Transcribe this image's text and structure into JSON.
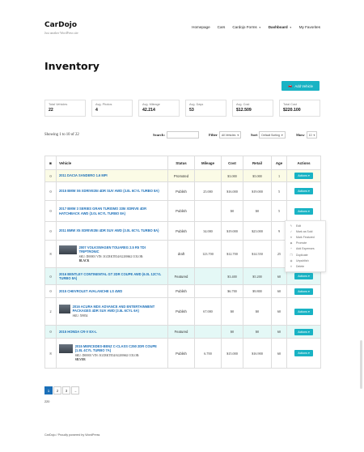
{
  "site": {
    "brand": "CarDojo",
    "tagline": "Just another WordPress site"
  },
  "nav": [
    {
      "label": "Homepage",
      "chevron": false
    },
    {
      "label": "Cars",
      "chevron": false
    },
    {
      "label": "Cardojo Forms",
      "chevron": true
    },
    {
      "label": "Dashboard",
      "chevron": true,
      "bold": true
    },
    {
      "label": "My Favorites",
      "chevron": false
    }
  ],
  "page_title": "Inventory",
  "add_vehicle": {
    "icon": "car-icon",
    "label": "Add Vehicle"
  },
  "stats": [
    {
      "label": "Total Vehicles",
      "value": "22"
    },
    {
      "label": "Avg. Photos",
      "value": "4"
    },
    {
      "label": "Avg. Mileage",
      "value": "42.214"
    },
    {
      "label": "Avg. Days",
      "value": "53"
    },
    {
      "label": "Avg. Cost",
      "value": "$12.509"
    },
    {
      "label": "Total Cost",
      "value": "$220.100"
    }
  ],
  "showing": "Showing 1 to 10 of 22",
  "controls": {
    "search_label": "Search:",
    "filter_label": "Filter",
    "filter_value": "All Vehicles",
    "sort_label": "Sort",
    "sort_value": "Default Sorting",
    "show_label": "Show",
    "show_value": "10"
  },
  "table": {
    "headers": [
      "",
      "Vehicle",
      "Status",
      "Mileage",
      "Cost",
      "Retail",
      "Age",
      "Actions"
    ],
    "action_label": "Actions",
    "rows": [
      {
        "photos": "0",
        "name": "2011 DACIA SANDERO 1.6 MPI",
        "status": "Promoted",
        "mileage": "",
        "cost": "$3.000",
        "retail": "$5.000",
        "age": "1",
        "hl": "yellow",
        "thumb": false
      },
      {
        "photos": "0",
        "name": "2015 BMW X6 XDRIVE35I 4DR SUV AWD (3.0L 6CYL TURBO 8A)",
        "status": "Publish",
        "mileage": "25.000",
        "cost": "$16.000",
        "retail": "$19.000",
        "age": "5",
        "hl": "",
        "thumb": false
      },
      {
        "photos": "0",
        "name": "2017 BMW 3 SERIES GRAN TURISMO 335I XDRIVE 4DR HATCHBACK AWD (3.0L 6CYL TURBO 8A)",
        "status": "Publish",
        "mileage": "",
        "cost": "$0",
        "retail": "$0",
        "age": "5",
        "hl": "",
        "thumb": false
      },
      {
        "photos": "0",
        "name": "2011 BMW X5 XDRIVE35I 4DR SUV AWD (3.0L 6CYL TURBO 8A)",
        "status": "Publish",
        "mileage": "34.000",
        "cost": "$19.000",
        "retail": "$23.000",
        "age": "9",
        "hl": "",
        "thumb": false
      },
      {
        "photos": "8",
        "name": "2007 VOLKSWAGEN TOUAREG 2.5 R5 TDI TRIPTRONIC",
        "status": "draft",
        "mileage": "123.700",
        "cost": "$12.700",
        "retail": "$14.550",
        "age": "25",
        "hl": "",
        "thumb": true,
        "meta": [
          "SKU: D00001 VIN: 3GCRKTE34AG200662 COLOR:",
          "BLACK"
        ]
      },
      {
        "photos": "0",
        "name": "2016 BENTLEY CONTINENTAL GT 2DR COUPE AWD (6.0L 12CYL TURBO 8A)",
        "status": "Featured",
        "mileage": "",
        "cost": "$3.400",
        "retail": "$5.200",
        "age": "60",
        "hl": "cyan",
        "thumb": false
      },
      {
        "photos": "0",
        "name": "2015 CHEVROLET AVALANCHE LS 4WD",
        "status": "Publish",
        "mileage": "",
        "cost": "$6.700",
        "retail": "$9.800",
        "age": "60",
        "hl": "",
        "thumb": false
      },
      {
        "photos": "2",
        "name": "2016 ACURA MDX ADVANCE AND ENTERTAINMENT PACKAGES 4DR SUV AWD (3.5L 6CYL 6A)",
        "status": "Publish",
        "mileage": "67.000",
        "cost": "$0",
        "retail": "$0",
        "age": "60",
        "hl": "",
        "thumb": true,
        "meta": [
          "SKU: X9854"
        ]
      },
      {
        "photos": "0",
        "name": "2015 HONDA CR-V EX-L",
        "status": "Featured",
        "mileage": "",
        "cost": "$0",
        "retail": "$0",
        "age": "60",
        "hl": "cyan",
        "thumb": false
      },
      {
        "photos": "8",
        "name": "2015 MERCEDES-BENZ C-CLASS C250 2DR COUPE (1.8L 4CYL TURBO 7A)",
        "status": "Publish",
        "mileage": "6.700",
        "cost": "$15.000",
        "retail": "$16.900",
        "age": "60",
        "hl": "",
        "thumb": true,
        "meta": [
          "SKU: D00001 VIN: 3GCRKTE34AG200662 COLOR:",
          "SILVER"
        ]
      }
    ]
  },
  "actions_menu": [
    {
      "icon": "pencil-icon",
      "glyph": "✎",
      "label": "Edit"
    },
    {
      "icon": "check-icon",
      "glyph": "✓",
      "label": "Mark as Sold"
    },
    {
      "icon": "star-icon",
      "glyph": "★",
      "label": "Mark Featured"
    },
    {
      "icon": "megaphone-icon",
      "glyph": "◆",
      "label": "Promote"
    },
    {
      "icon": "plus-icon",
      "glyph": "+",
      "label": "Add Expenses"
    },
    {
      "icon": "copy-icon",
      "glyph": "❐",
      "label": "Duplicate"
    },
    {
      "icon": "eye-off-icon",
      "glyph": "◉",
      "label": "Unpublish"
    },
    {
      "icon": "trash-icon",
      "glyph": "✕",
      "label": "Delete"
    }
  ],
  "pagination": {
    "pages": [
      "1",
      "2",
      "3",
      "→"
    ],
    "active": "1"
  },
  "total_count": "220",
  "footer": "CarDojo  /  Proudly powered by WordPress",
  "colors": {
    "accent": "#19b3c4",
    "link": "#1b6fb8",
    "featured_row": "#e4f8f6",
    "promoted_row": "#fbfbe6"
  }
}
